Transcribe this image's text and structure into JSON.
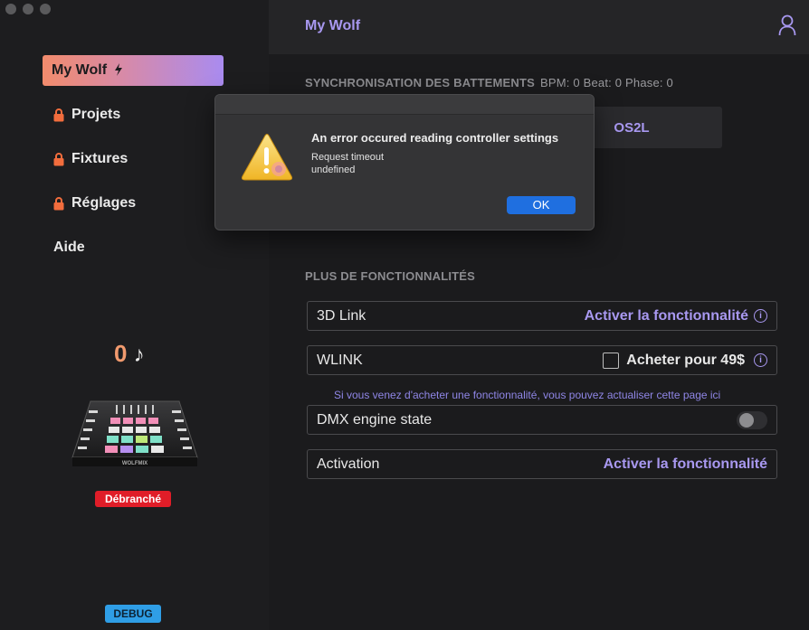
{
  "app": {
    "title": "My Wolf"
  },
  "sidebar": {
    "items": [
      {
        "label": "My Wolf",
        "active": true,
        "icon": "bolt-icon"
      },
      {
        "label": "Projets",
        "locked": true
      },
      {
        "label": "Fixtures",
        "locked": true
      },
      {
        "label": "Réglages",
        "locked": true
      },
      {
        "label": "Aide",
        "locked": false
      }
    ],
    "bpm_value": "0",
    "bpm_symbol": "♪",
    "device_brand": "WOLFMIX",
    "status_badge": "Débranché",
    "debug_badge": "DEBUG"
  },
  "sync": {
    "title": "SYNCHRONISATION DES BATTEMENTS",
    "meta": "BPM: 0 Beat: 0 Phase: 0",
    "os2l_label": "OS2L"
  },
  "features": {
    "title": "PLUS DE FONCTIONNALITÉS",
    "link3d": {
      "name": "3D Link",
      "action": "Activer la fonctionnalité"
    },
    "wlink": {
      "name": "WLINK",
      "action": "Acheter pour 49$"
    },
    "refresh_note": "Si vous venez d'acheter une fonctionnalité, vous pouvez actualiser cette page ici",
    "dmx": {
      "name": "DMX engine state"
    },
    "activation": {
      "name": "Activation",
      "action": "Activer la fonctionnalité"
    }
  },
  "dialog": {
    "title": "An error occured reading controller settings",
    "line1": "Request timeout",
    "line2": "undefined",
    "ok_label": "OK"
  },
  "colors": {
    "accent": "#a898f0",
    "active_gradient_start": "#f28b6c",
    "status_red": "#e01d28",
    "debug_blue": "#2f9ee6",
    "ok_blue": "#1f6fe0"
  }
}
